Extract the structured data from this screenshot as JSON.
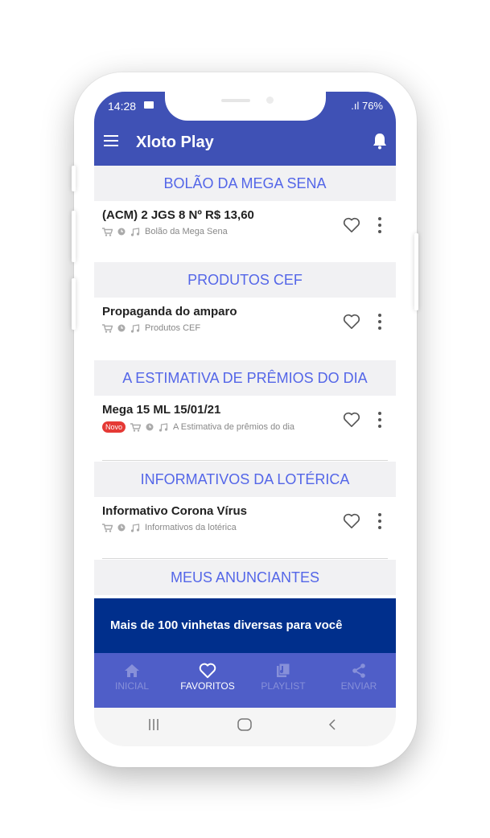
{
  "status_bar": {
    "time": "14:28",
    "battery": ".ıl 76%"
  },
  "app_bar": {
    "title": "Xloto Play"
  },
  "sections": [
    {
      "header": "BOLÃO DA MEGA SENA",
      "item": {
        "title": "(ACM) 2 JGS 8 Nº R$ 13,60",
        "category": "Bolão da Mega Sena",
        "is_new": false
      }
    },
    {
      "header": "PRODUTOS CEF",
      "item": {
        "title": "Propaganda do amparo",
        "category": "Produtos CEF",
        "is_new": false
      }
    },
    {
      "header": "A ESTIMATIVA DE PRÊMIOS DO DIA",
      "item": {
        "title": "Mega 15 ML 15/01/21",
        "category": "A Estimativa de prêmios do dia",
        "is_new": true,
        "badge": "Novo"
      }
    },
    {
      "header": "INFORMATIVOS DA LOTÉRICA",
      "item": {
        "title": "Informativo Corona Vírus",
        "category": "Informativos da lotérica",
        "is_new": false
      }
    },
    {
      "header": "MEUS ANUNCIANTES"
    }
  ],
  "banner": {
    "text": "Mais de 100 vinhetas diversas para você"
  },
  "bottom_nav": [
    {
      "label": "INICIAL",
      "icon": "home-icon",
      "active": false
    },
    {
      "label": "FAVORITOS",
      "icon": "heart-icon",
      "active": true
    },
    {
      "label": "PLAYLIST",
      "icon": "playlist-icon",
      "active": false
    },
    {
      "label": "ENVIAR",
      "icon": "share-icon",
      "active": false
    }
  ],
  "colors": {
    "primary": "#3f51b5",
    "section_text": "#5466e8",
    "banner": "#002f8c",
    "badge": "#e53935"
  }
}
